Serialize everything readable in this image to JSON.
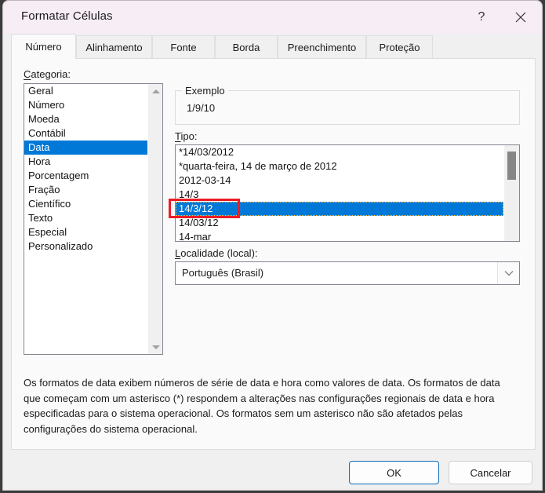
{
  "window": {
    "title": "Formatar Células",
    "help_glyph": "?",
    "close_glyph": "✕"
  },
  "tabs": [
    {
      "label": "Número",
      "active": true
    },
    {
      "label": "Alinhamento",
      "active": false
    },
    {
      "label": "Fonte",
      "active": false
    },
    {
      "label": "Borda",
      "active": false
    },
    {
      "label": "Preenchimento",
      "active": false
    },
    {
      "label": "Proteção",
      "active": false
    }
  ],
  "categoria": {
    "label_accel": "C",
    "label_rest": "ategoria:",
    "items": [
      "Geral",
      "Número",
      "Moeda",
      "Contábil",
      "Data",
      "Hora",
      "Porcentagem",
      "Fração",
      "Científico",
      "Texto",
      "Especial",
      "Personalizado"
    ],
    "selected_index": 4
  },
  "exemplo": {
    "legend": "Exemplo",
    "value": "1/9/10"
  },
  "tipo": {
    "label_accel": "T",
    "label_rest": "ipo:",
    "items": [
      "*14/03/2012",
      "*quarta-feira, 14 de março de 2012",
      "2012-03-14",
      "14/3",
      "14/3/12",
      "14/03/12",
      "14-mar"
    ],
    "selected_index": 4
  },
  "localidade": {
    "label_accel": "L",
    "label_rest": "ocalidade (local):",
    "value": "Português (Brasil)"
  },
  "description": "Os formatos de data exibem números de série de data e hora como valores de data. Os formatos de data que começam com um asterisco (*) respondem a alterações nas configurações regionais de data e hora especificadas para o sistema operacional. Os formatos sem um asterisco não são afetados pelas configurações do sistema operacional.",
  "footer": {
    "ok_label": "OK",
    "cancel_label": "Cancelar"
  },
  "colors": {
    "selection_blue": "#0078d7",
    "annotation_red": "#ee1c25",
    "titlebar": "#f7edf5",
    "accent_border": "#0f6cbd"
  }
}
